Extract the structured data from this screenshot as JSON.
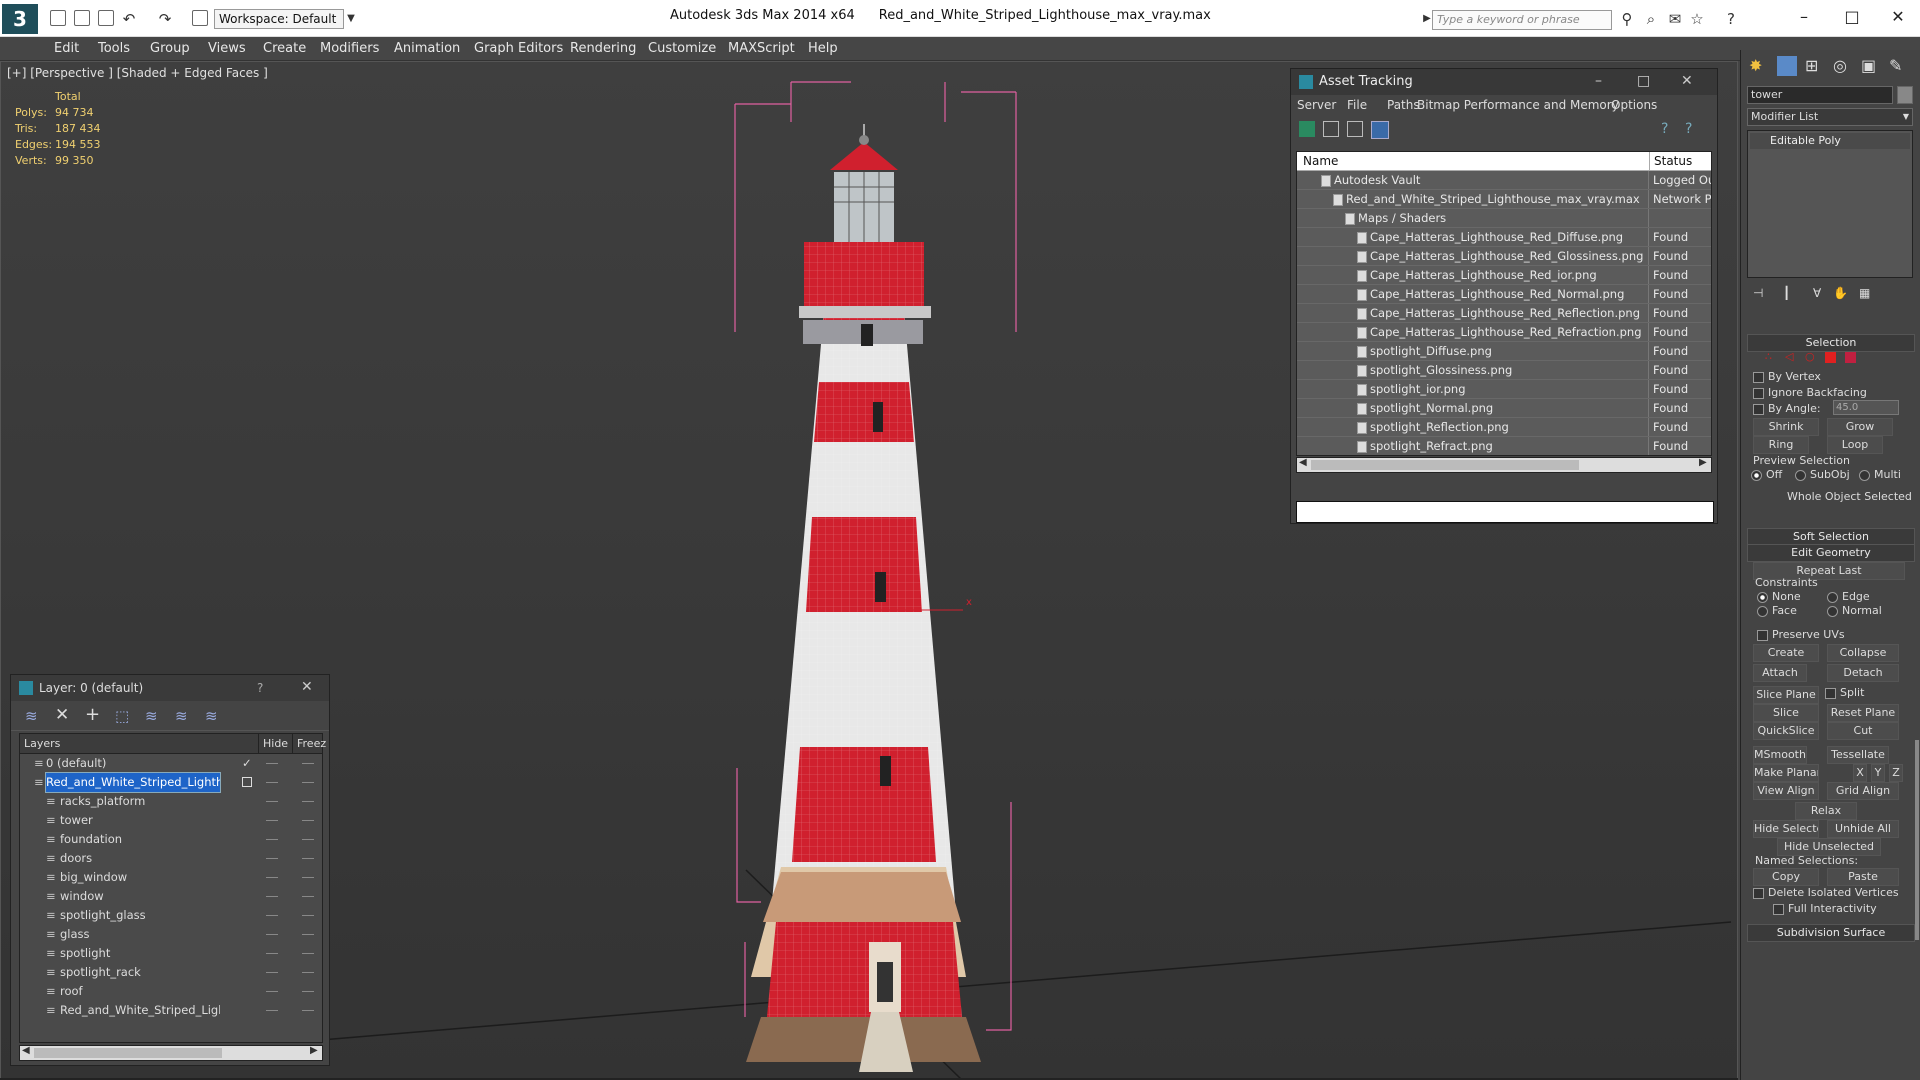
{
  "app": {
    "title": "Autodesk 3ds Max  2014 x64",
    "file": "Red_and_White_Striped_Lighthouse_max_vray.max",
    "workspace": "Workspace: Default",
    "search_placeholder": "Type a keyword or phrase"
  },
  "menu": [
    "Edit",
    "Tools",
    "Group",
    "Views",
    "Create",
    "Modifiers",
    "Animation",
    "Graph Editors",
    "Rendering",
    "Customize",
    "MAXScript",
    "Help"
  ],
  "viewport": {
    "label": "[+] [Perspective ] [Shaded + Edged Faces ]",
    "stats": {
      "header": "Total",
      "rows": [
        {
          "label": "Polys:",
          "value": "94 734"
        },
        {
          "label": "Tris:",
          "value": "187 434"
        },
        {
          "label": "Edges:",
          "value": "194 553"
        },
        {
          "label": "Verts:",
          "value": "99 350"
        }
      ]
    }
  },
  "asset_tracking": {
    "title": "Asset Tracking",
    "menus": [
      "Server",
      "File",
      "Paths",
      "Bitmap Performance and Memory",
      "Options"
    ],
    "col_name": "Name",
    "col_status": "Status",
    "rows": [
      {
        "name": "Autodesk Vault",
        "status": "Logged Ou",
        "indent": 2
      },
      {
        "name": "Red_and_White_Striped_Lighthouse_max_vray.max",
        "status": "Network P",
        "indent": 3
      },
      {
        "name": "Maps / Shaders",
        "status": "",
        "indent": 4
      },
      {
        "name": "Cape_Hatteras_Lighthouse_Red_Diffuse.png",
        "status": "Found",
        "indent": 5
      },
      {
        "name": "Cape_Hatteras_Lighthouse_Red_Glossiness.png",
        "status": "Found",
        "indent": 5
      },
      {
        "name": "Cape_Hatteras_Lighthouse_Red_ior.png",
        "status": "Found",
        "indent": 5
      },
      {
        "name": "Cape_Hatteras_Lighthouse_Red_Normal.png",
        "status": "Found",
        "indent": 5
      },
      {
        "name": "Cape_Hatteras_Lighthouse_Red_Reflection.png",
        "status": "Found",
        "indent": 5
      },
      {
        "name": "Cape_Hatteras_Lighthouse_Red_Refraction.png",
        "status": "Found",
        "indent": 5
      },
      {
        "name": "spotlight_Diffuse.png",
        "status": "Found",
        "indent": 5
      },
      {
        "name": "spotlight_Glossiness.png",
        "status": "Found",
        "indent": 5
      },
      {
        "name": "spotlight_ior.png",
        "status": "Found",
        "indent": 5
      },
      {
        "name": "spotlight_Normal.png",
        "status": "Found",
        "indent": 5
      },
      {
        "name": "spotlight_Reflection.png",
        "status": "Found",
        "indent": 5
      },
      {
        "name": "spotlight_Refract.png",
        "status": "Found",
        "indent": 5
      }
    ]
  },
  "layer_panel": {
    "title": "Layer: 0 (default)",
    "help": "?",
    "col_layers": "Layers",
    "col_hide": "Hide",
    "col_freeze": "Freez",
    "rows": [
      {
        "name": "0 (default)",
        "level": 1,
        "selected": false
      },
      {
        "name": "Red_and_White_Striped_Lighthouse",
        "level": 1,
        "selected": true
      },
      {
        "name": "racks_platform",
        "level": 2,
        "selected": false
      },
      {
        "name": "tower",
        "level": 2,
        "selected": false
      },
      {
        "name": "foundation",
        "level": 2,
        "selected": false
      },
      {
        "name": "doors",
        "level": 2,
        "selected": false
      },
      {
        "name": "big_window",
        "level": 2,
        "selected": false
      },
      {
        "name": "window",
        "level": 2,
        "selected": false
      },
      {
        "name": "spotlight_glass",
        "level": 2,
        "selected": false
      },
      {
        "name": "glass",
        "level": 2,
        "selected": false
      },
      {
        "name": "spotlight",
        "level": 2,
        "selected": false
      },
      {
        "name": "spotlight_rack",
        "level": 2,
        "selected": false
      },
      {
        "name": "roof",
        "level": 2,
        "selected": false
      },
      {
        "name": "Red_and_White_Striped_Lighthous",
        "level": 2,
        "selected": false
      }
    ]
  },
  "command_panel": {
    "object_name": "tower",
    "modifier_list": "Modifier List",
    "stack_item": "Editable Poly",
    "selection": "Selection",
    "by_vertex": "By Vertex",
    "ignore_backfacing": "Ignore Backfacing",
    "by_angle": "By Angle:",
    "angle_value": "45.0",
    "shrink": "Shrink",
    "grow": "Grow",
    "ring": "Ring",
    "loop": "Loop",
    "preview_selection": "Preview Selection",
    "off": "Off",
    "subobj": "SubObj",
    "multi": "Multi",
    "whole_object": "Whole Object Selected",
    "soft_selection": "Soft Selection",
    "edit_geometry": "Edit Geometry",
    "repeat_last": "Repeat Last",
    "constraints": "Constraints",
    "none": "None",
    "edge": "Edge",
    "face": "Face",
    "normal": "Normal",
    "preserve_uvs": "Preserve UVs",
    "create": "Create",
    "collapse": "Collapse",
    "attach": "Attach",
    "detach": "Detach",
    "slice_plane": "Slice Plane",
    "split": "Split",
    "slice": "Slice",
    "reset_plane": "Reset Plane",
    "quickslice": "QuickSlice",
    "cut": "Cut",
    "msmooth": "MSmooth",
    "tessellate": "Tessellate",
    "make_planar": "Make Planar",
    "x": "X",
    "y": "Y",
    "z": "Z",
    "view_align": "View Align",
    "grid_align": "Grid Align",
    "relax": "Relax",
    "hide_selected": "Hide Selected",
    "unhide_all": "Unhide All",
    "hide_unselected": "Hide Unselected",
    "named_selections": "Named Selections:",
    "copy": "Copy",
    "paste": "Paste",
    "delete_isolated": "Delete Isolated Vertices",
    "full_interactivity": "Full Interactivity",
    "subdivision_surface": "Subdivision Surface"
  },
  "colors": {
    "accent": "#1e64c8",
    "stats": "#f0d070",
    "stripe_red": "#d0202e",
    "bbox": "#e060a0"
  }
}
